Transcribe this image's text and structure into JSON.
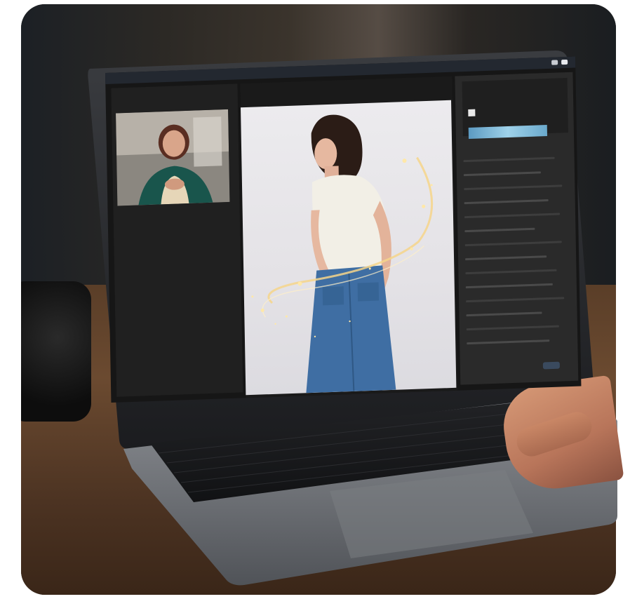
{
  "scene": {
    "subject": "laptop",
    "accent_colors": {
      "app_topbar": "#232830",
      "histogram": "#9fd2ea",
      "sparkle": "#f6d58a"
    }
  },
  "app": {
    "topbar": {
      "items": [
        "",
        "",
        "",
        ""
      ]
    },
    "left_panel": {
      "label": ""
    },
    "right_panel": {
      "tabs": [
        "",
        ""
      ]
    }
  }
}
